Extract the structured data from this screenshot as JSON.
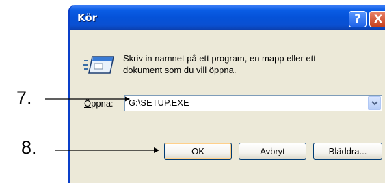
{
  "window": {
    "title": "Kör",
    "help_glyph": "?",
    "close_glyph": "X",
    "titlebar_color": "#0552d8",
    "body_color": "#ece9d8"
  },
  "prompt": "Skriv in namnet på ett program, en mapp eller ett dokument som du vill öppna.",
  "open": {
    "label_accesskey": "Ö",
    "label_rest": "ppna:",
    "value": "G:\\SETUP.EXE"
  },
  "buttons": {
    "ok": "OK",
    "cancel": "Avbryt",
    "browse": "Bläddra..."
  },
  "annotations": {
    "step7": "7.",
    "step8": "8."
  },
  "icons": {
    "run": "run-program-icon",
    "dropdown": "chevron-down-icon"
  }
}
